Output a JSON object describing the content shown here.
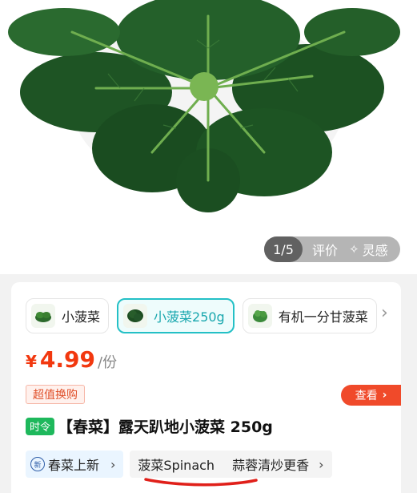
{
  "gallery": {
    "counter": "1/5",
    "reviews_label": "评价",
    "inspiration_label": "灵感"
  },
  "variants": [
    {
      "label": "小菠菜",
      "selected": false
    },
    {
      "label": "小菠菜250g",
      "selected": true
    },
    {
      "label": "有机一分甘菠菜",
      "selected": false
    }
  ],
  "price": {
    "currency": "¥",
    "value": "4.99",
    "unit": "/份"
  },
  "deal_tag": "超值换购",
  "look_button": "查看",
  "season_badge": "时令",
  "title": "【春菜】露天趴地小菠菜 250g",
  "tags": {
    "new_label": "春菜上新",
    "search_1": "菠菜Spinach",
    "search_2": "蒜蓉清炒更香"
  },
  "colors": {
    "price": "#f2380f",
    "accent": "#24c0c6",
    "season": "#1eb85c",
    "look_button": "#f04a2a",
    "annotation": "#e0201a"
  }
}
